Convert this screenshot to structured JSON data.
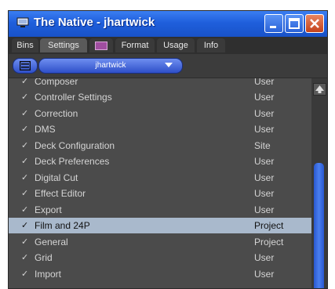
{
  "window": {
    "title": "The Native - jhartwick",
    "icons": {
      "app": "monitor-icon",
      "minimize": "minimize-icon",
      "maximize": "maximize-icon",
      "close": "close-icon"
    },
    "colors": {
      "titlebar": "#1f5fdc",
      "close_button": "#d2542c",
      "selected_row": "#a9b9cc"
    }
  },
  "tabs": [
    {
      "label": "Bins"
    },
    {
      "label": "Settings",
      "active": true
    },
    {
      "label": "",
      "icon": "color-swatch-icon",
      "color": "#a04ea0"
    },
    {
      "label": "Format"
    },
    {
      "label": "Usage"
    },
    {
      "label": "Info"
    }
  ],
  "toolbar": {
    "menu_icon": "fast-menu-icon",
    "user_select": {
      "value": "jhartwick",
      "icon": "chevron-down-icon"
    }
  },
  "settings": {
    "rows": [
      {
        "check": "✓",
        "name": "Composer",
        "scope": "User"
      },
      {
        "check": "✓",
        "name": "Controller Settings",
        "scope": "User"
      },
      {
        "check": "✓",
        "name": "Correction",
        "scope": "User"
      },
      {
        "check": "✓",
        "name": "DMS",
        "scope": "User"
      },
      {
        "check": "✓",
        "name": "Deck Configuration",
        "scope": "Site"
      },
      {
        "check": "✓",
        "name": "Deck Preferences",
        "scope": "User"
      },
      {
        "check": "✓",
        "name": "Digital Cut",
        "scope": "User"
      },
      {
        "check": "✓",
        "name": "Effect Editor",
        "scope": "User"
      },
      {
        "check": "✓",
        "name": "Export",
        "scope": "User"
      },
      {
        "check": "✓",
        "name": "Film and 24P",
        "scope": "Project",
        "selected": true
      },
      {
        "check": "✓",
        "name": "General",
        "scope": "Project"
      },
      {
        "check": "✓",
        "name": "Grid",
        "scope": "User"
      },
      {
        "check": "✓",
        "name": "Import",
        "scope": "User"
      }
    ]
  },
  "scrollbar": {
    "up_icon": "arrow-up-icon"
  }
}
